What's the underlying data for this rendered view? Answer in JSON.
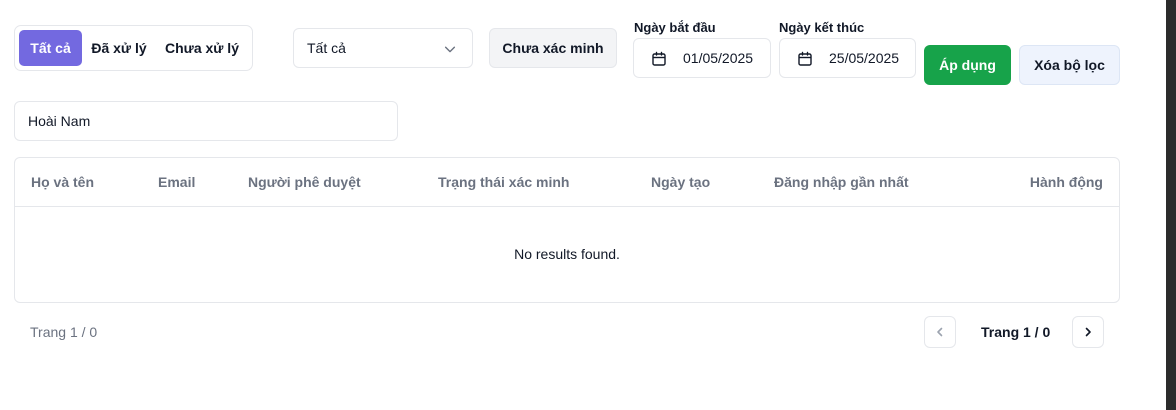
{
  "filters": {
    "tabs": [
      "Tất cả",
      "Đã xử lý",
      "Chưa xử lý"
    ],
    "active_tab": 0,
    "select_value": "Tất cả",
    "unverified_label": "Chưa xác minh",
    "start_date_label": "Ngày bắt đầu",
    "start_date_value": "01/05/2025",
    "end_date_label": "Ngày kết thúc",
    "end_date_value": "25/05/2025",
    "apply_label": "Áp dụng",
    "clear_label": "Xóa bộ lọc"
  },
  "search": {
    "value": "Hoài Nam"
  },
  "table": {
    "columns": [
      "Họ và tên",
      "Email",
      "Người phê duyệt",
      "Trạng thái xác minh",
      "Ngày tạo",
      "Đăng nhập gần nhất",
      "Hành động"
    ],
    "empty_text": "No results found."
  },
  "pagination": {
    "left_text": "Trang 1 / 0",
    "current_text": "Trang 1 / 0"
  },
  "colors": {
    "active_tab": "#7369e0",
    "apply": "#17a34a",
    "clear_bg": "#eef3fd"
  }
}
